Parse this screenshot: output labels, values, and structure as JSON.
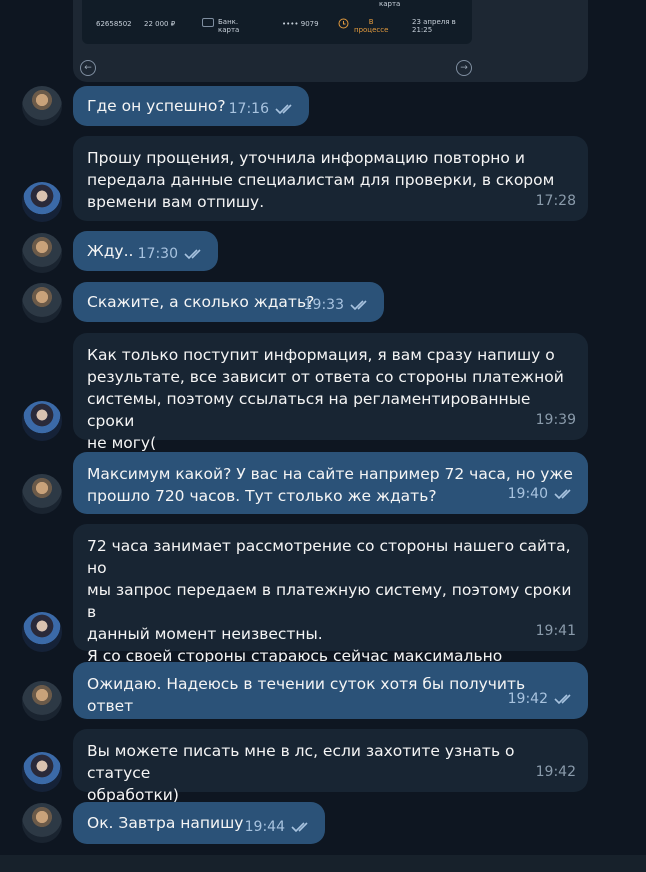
{
  "screenshot_card": {
    "header": "карта",
    "row": {
      "id": "62658502",
      "amount": "22 000 ₽",
      "method_line1": "Банк.",
      "method_line2": "карта",
      "card_mask": "•••• 9079",
      "status_line1": "В",
      "status_line2": "процессе",
      "date_line1": "23 апреля в",
      "date_line2": "21:25"
    },
    "prev_icon": "←",
    "next_icon": "→"
  },
  "messages": [
    {
      "sender": "user",
      "text": "Где он успешно?",
      "time": "17:16",
      "read": true
    },
    {
      "sender": "agent",
      "text": "Прошу прощения, уточнила информацию повторно и\nпередала данные специалистам для проверки, в скором\nвремени вам отпишу.",
      "time": "17:28"
    },
    {
      "sender": "user",
      "text": "Жду..",
      "time": "17:30",
      "read": true
    },
    {
      "sender": "user",
      "text": "Скажите, а сколько ждать?",
      "time": "19:33",
      "read": true
    },
    {
      "sender": "agent",
      "text": "Как только поступит информация, я вам сразу напишу о\nрезультате, все зависит от ответа со стороны платежной\nсистемы, поэтому ссылаться на регламентированные сроки\nне могу(",
      "time": "19:39"
    },
    {
      "sender": "user",
      "text": "Максимум какой? У вас на сайте например 72 часа, но уже\nпрошло 720 часов. Тут столько же ждать?",
      "time": "19:40",
      "read": true
    },
    {
      "sender": "agent",
      "text": "72 часа занимает рассмотрение со стороны нашего сайта, но\nмы запрос передаем в платежную систему, поэтому сроки в\nданный момент неизвестны.\nЯ со своей стороны стараюсь сейчас максимально ускорить\nпроцесс🙏",
      "time": "19:41"
    },
    {
      "sender": "user",
      "text": "Ожидаю. Надеюсь в течении суток хотя бы получить ответ",
      "time": "19:42",
      "read": true
    },
    {
      "sender": "agent",
      "text": "Вы можете писать мне в лс, если захотите узнать о статусе\nобработки)",
      "time": "19:42"
    },
    {
      "sender": "user",
      "text": "Ок. Завтра напишу",
      "time": "19:44",
      "read": true
    }
  ]
}
